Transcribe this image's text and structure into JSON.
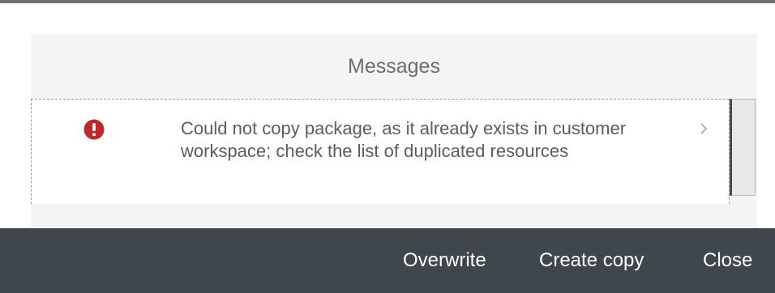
{
  "dialog": {
    "messages_title": "Messages",
    "messages": [
      {
        "type": "error",
        "icon": "error-icon",
        "text": "Could not copy package, as it already exists in customer workspace; check the list of duplicated resources"
      }
    ]
  },
  "footer": {
    "overwrite_label": "Overwrite",
    "create_copy_label": "Create copy",
    "close_label": "Close"
  },
  "colors": {
    "error": "#c0272d",
    "footer_bg": "#3f474c",
    "panel_bg": "#f4f4f4",
    "title_text": "#6a6d70"
  }
}
